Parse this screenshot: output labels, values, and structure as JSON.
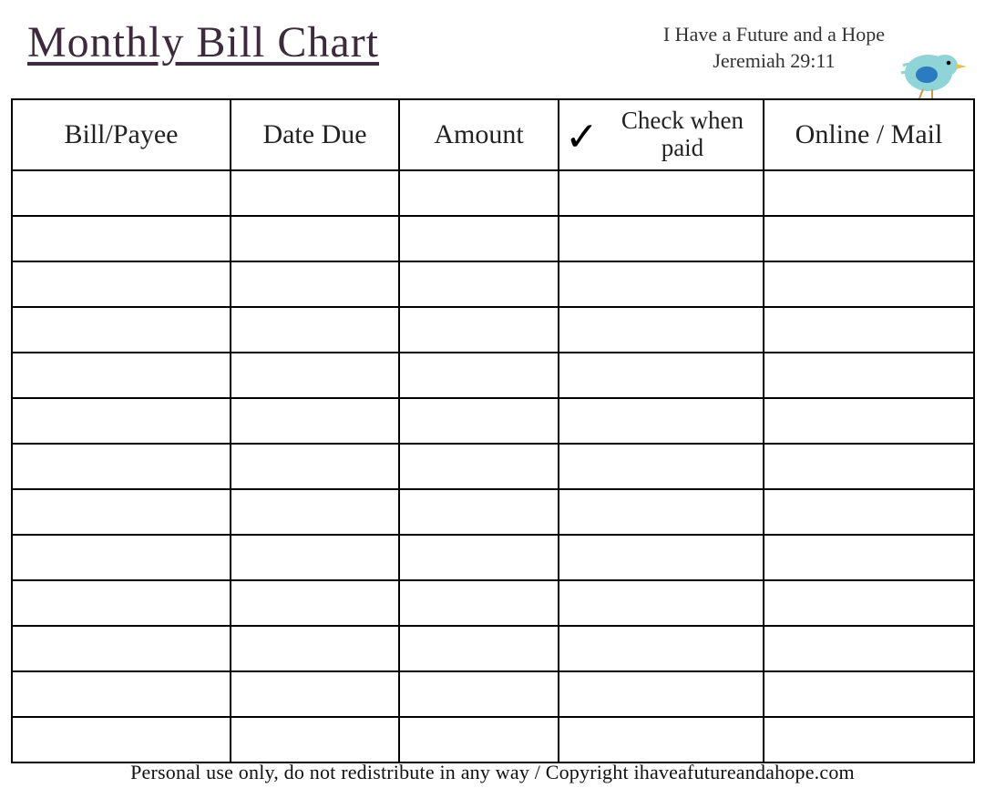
{
  "header": {
    "title": "Monthly Bill Chart",
    "quote_line1": "I Have a Future and a Hope",
    "quote_line2": "Jeremiah 29:11"
  },
  "columns": {
    "payee": "Bill/Payee",
    "date_due": "Date Due",
    "amount": "Amount",
    "check_when_paid": "Check when paid",
    "online_mail": "Online / Mail"
  },
  "check_symbol": "✓",
  "row_count": 13,
  "footer": "Personal use only, do not redistribute in any way / Copyright ihaveafutureandahope.com"
}
